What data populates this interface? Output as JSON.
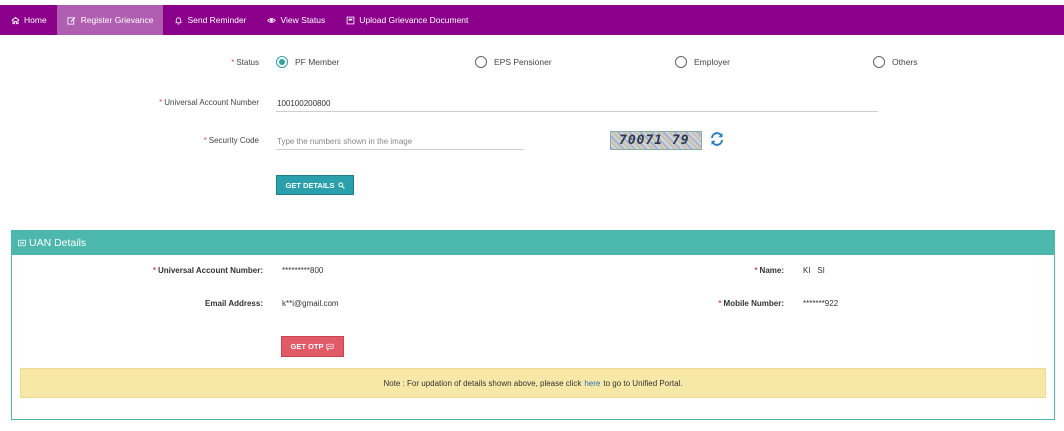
{
  "nav": {
    "items": [
      {
        "label": "Home",
        "icon": "home-icon"
      },
      {
        "label": "Register Grievance",
        "icon": "edit-icon",
        "active": true
      },
      {
        "label": "Send Reminder",
        "icon": "bell-icon"
      },
      {
        "label": "View Status",
        "icon": "eye-icon"
      },
      {
        "label": "Upload Grievance Document",
        "icon": "upload-doc-icon"
      }
    ],
    "bg_color": "#8b008b",
    "active_color": "#b05fb0"
  },
  "form": {
    "status_label": "Status",
    "status_options": [
      "PF Member",
      "EPS Pensioner",
      "Employer",
      "Others"
    ],
    "status_selected": "PF Member",
    "uan_label": "Universal Account Number",
    "uan_value": "100100200800",
    "security_label": "Security Code",
    "security_placeholder": "Type the numbers shown in the image",
    "captcha_text": "70071 79",
    "get_details_label": "GET DETAILS",
    "accent_color": "#2aa0ac"
  },
  "uan_details": {
    "title": "UAN Details",
    "uan_label": "Universal Account Number:",
    "uan_value": "*********800",
    "name_label": "Name:",
    "name_value": "KI   SI",
    "email_label": "Email Address:",
    "email_value": "k**i@gmail.com",
    "mobile_label": "Mobile Number:",
    "mobile_value": "*******922",
    "get_otp_label": "GET OTP",
    "header_color": "#4cb7ad",
    "otp_color": "#e05a67"
  },
  "note": {
    "prefix": "Note : For updation of details shown above, please click",
    "link": "here",
    "suffix": "to go to Unified Portal."
  }
}
